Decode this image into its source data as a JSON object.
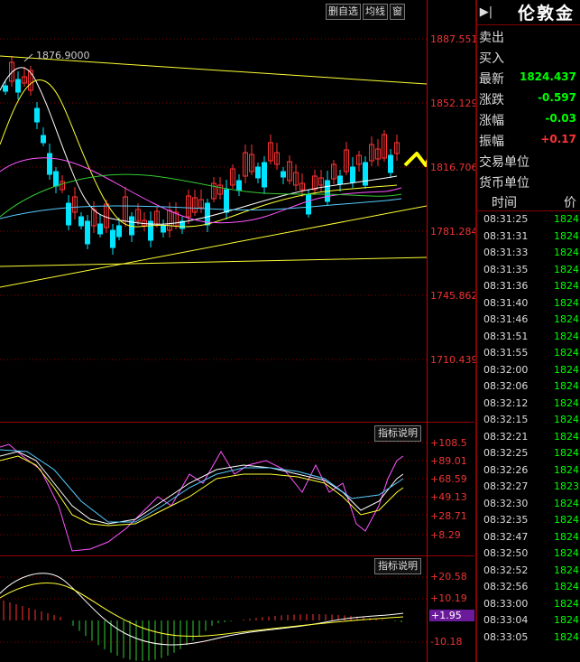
{
  "toolbar": {
    "delete_label": "删自选",
    "ma_label": "均线",
    "window_label": "窗"
  },
  "main_chart": {
    "peak_label": "1876.9000",
    "price_axis": [
      "1887.551",
      "1852.129",
      "1816.706",
      "1781.284",
      "1745.862",
      "1710.439"
    ]
  },
  "kdj_panel": {
    "desc_label": "指标说明",
    "axis": [
      "+108.5",
      "+89.01",
      "+68.59",
      "+49.13",
      "+28.71",
      "+8.29"
    ]
  },
  "macd_panel": {
    "desc_label": "指标说明",
    "axis": [
      "+20.58",
      "+10.19",
      "-10.18"
    ],
    "highlight": "+1.95"
  },
  "side": {
    "menu_icon": "▶|",
    "title": "伦敦金",
    "quote": [
      {
        "label": "卖出",
        "value": ""
      },
      {
        "label": "买入",
        "value": ""
      },
      {
        "label": "最新",
        "value": "1824.437"
      },
      {
        "label": "涨跌",
        "value": "-0.597"
      },
      {
        "label": "涨幅",
        "value": "-0.03"
      },
      {
        "label": "振幅",
        "value": "+0.17"
      },
      {
        "label": "交易单位",
        "value": ""
      },
      {
        "label": "货币单位",
        "value": ""
      }
    ],
    "tick_header": {
      "time": "时间",
      "price": "价"
    },
    "ticks": [
      {
        "time": "08:31:25",
        "price": "1824"
      },
      {
        "time": "08:31:31",
        "price": "1824"
      },
      {
        "time": "08:31:33",
        "price": "1824"
      },
      {
        "time": "08:31:35",
        "price": "1824"
      },
      {
        "time": "08:31:36",
        "price": "1824"
      },
      {
        "time": "08:31:40",
        "price": "1824"
      },
      {
        "time": "08:31:46",
        "price": "1824"
      },
      {
        "time": "08:31:51",
        "price": "1824"
      },
      {
        "time": "08:31:55",
        "price": "1824"
      },
      {
        "time": "08:32:00",
        "price": "1824"
      },
      {
        "time": "08:32:06",
        "price": "1824"
      },
      {
        "time": "08:32:12",
        "price": "1824"
      },
      {
        "time": "08:32:15",
        "price": "1824"
      },
      {
        "time": "08:32:21",
        "price": "1824"
      },
      {
        "time": "08:32:25",
        "price": "1824"
      },
      {
        "time": "08:32:26",
        "price": "1824"
      },
      {
        "time": "08:32:27",
        "price": "1823"
      },
      {
        "time": "08:32:30",
        "price": "1824"
      },
      {
        "time": "08:32:35",
        "price": "1824"
      },
      {
        "time": "08:32:47",
        "price": "1824"
      },
      {
        "time": "08:32:50",
        "price": "1824"
      },
      {
        "time": "08:32:52",
        "price": "1824"
      },
      {
        "time": "08:32:56",
        "price": "1824"
      },
      {
        "time": "08:33:00",
        "price": "1824"
      },
      {
        "time": "08:33:04",
        "price": "1824"
      },
      {
        "time": "08:33:05",
        "price": "1824"
      }
    ]
  },
  "colors": {
    "up": "#ff3333",
    "down": "#00e5ff",
    "bg": "#000000",
    "grid": "#8a0000",
    "ma_white": "#ffffff",
    "ma_yellow": "#ffff33",
    "ma_magenta": "#ff55ff",
    "ma_green": "#33cc33",
    "ma_cyan": "#55ccff",
    "annotation": "#ffff00",
    "quote_green": "#00ff00",
    "quote_red": "#ff3333"
  }
}
